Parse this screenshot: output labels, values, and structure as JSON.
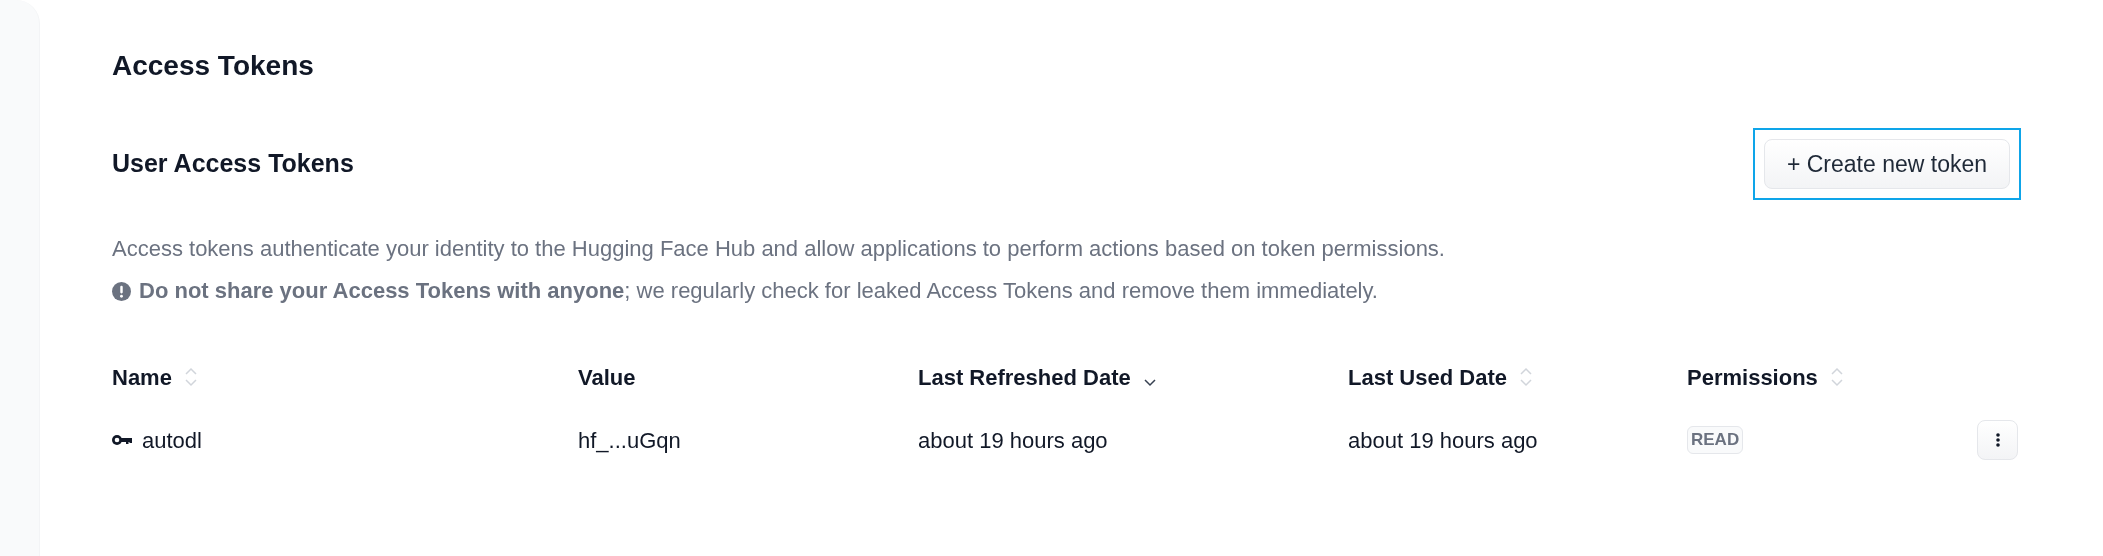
{
  "page_title": "Access Tokens",
  "section": {
    "title": "User Access Tokens",
    "create_button": {
      "label": "+ Create new token",
      "focused": true
    }
  },
  "description": "Access tokens authenticate your identity to the Hugging Face Hub and allow applications to perform actions based on token permissions.",
  "warning": "**Do not share your Access Tokens with anyone**; we regularly check for leaked Access Tokens and remove them immediately.",
  "table": {
    "columns": [
      {
        "label": "Name",
        "sortable": true,
        "sorted_descending": false
      },
      {
        "label": "Value",
        "sortable": false
      },
      {
        "label": "Last Refreshed Date",
        "sortable": true,
        "sorted_descending": true
      },
      {
        "label": "Last Used Date",
        "sortable": true,
        "sorted_descending": false
      },
      {
        "label": "Permissions",
        "sortable": true,
        "sorted_descending": false
      }
    ],
    "rows": [
      {
        "name": "autodl",
        "value": "hf_...uGqn",
        "last_refreshed": "about 19 hours ago",
        "last_used": "about 19 hours ago",
        "permission": "READ"
      }
    ]
  }
}
